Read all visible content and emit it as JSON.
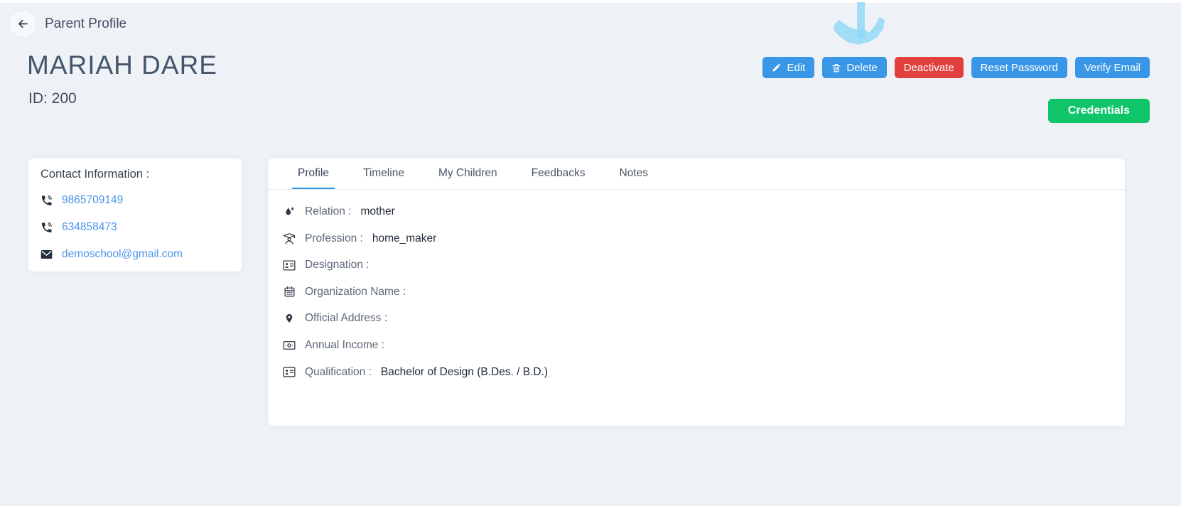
{
  "page": {
    "title": "Parent Profile",
    "back_icon": "arrow-left"
  },
  "profile": {
    "name": "MARIAH DARE",
    "id_label": "ID: 200"
  },
  "actions": {
    "edit": "Edit",
    "delete": "Delete",
    "deactivate": "Deactivate",
    "reset_password": "Reset Password",
    "verify_email": "Verify Email",
    "credentials": "Credentials"
  },
  "contact": {
    "heading": "Contact Information :",
    "items": [
      {
        "icon": "phone-icon",
        "text": "9865709149"
      },
      {
        "icon": "phone-icon",
        "text": "634858473"
      },
      {
        "icon": "email-icon",
        "text": "demoschool@gmail.com"
      }
    ]
  },
  "tabs": [
    {
      "label": "Profile",
      "active": true
    },
    {
      "label": "Timeline",
      "active": false
    },
    {
      "label": "My Children",
      "active": false
    },
    {
      "label": "Feedbacks",
      "active": false
    },
    {
      "label": "Notes",
      "active": false
    }
  ],
  "details": [
    {
      "icon": "relation-icon",
      "label": "Relation :",
      "value": "mother"
    },
    {
      "icon": "profession-icon",
      "label": "Profession :",
      "value": "home_maker"
    },
    {
      "icon": "designation-icon",
      "label": "Designation :",
      "value": ""
    },
    {
      "icon": "organization-icon",
      "label": "Organization Name :",
      "value": ""
    },
    {
      "icon": "address-icon",
      "label": "Official Address :",
      "value": ""
    },
    {
      "icon": "income-icon",
      "label": "Annual Income :",
      "value": ""
    },
    {
      "icon": "qualification-icon",
      "label": "Qualification :",
      "value": "Bachelor of Design (B.Des. / B.D.)"
    }
  ],
  "annotation": {
    "name": "down-arrow-annotation",
    "color": "#8ed7f8"
  },
  "colors": {
    "background": "#eef2f7",
    "primary_blue": "#3a97e8",
    "danger_red": "#e2403f",
    "success_green": "#10c469",
    "link_blue": "#4d94ea",
    "tab_underline": "#2e95e8",
    "heading_text": "#44546a"
  }
}
